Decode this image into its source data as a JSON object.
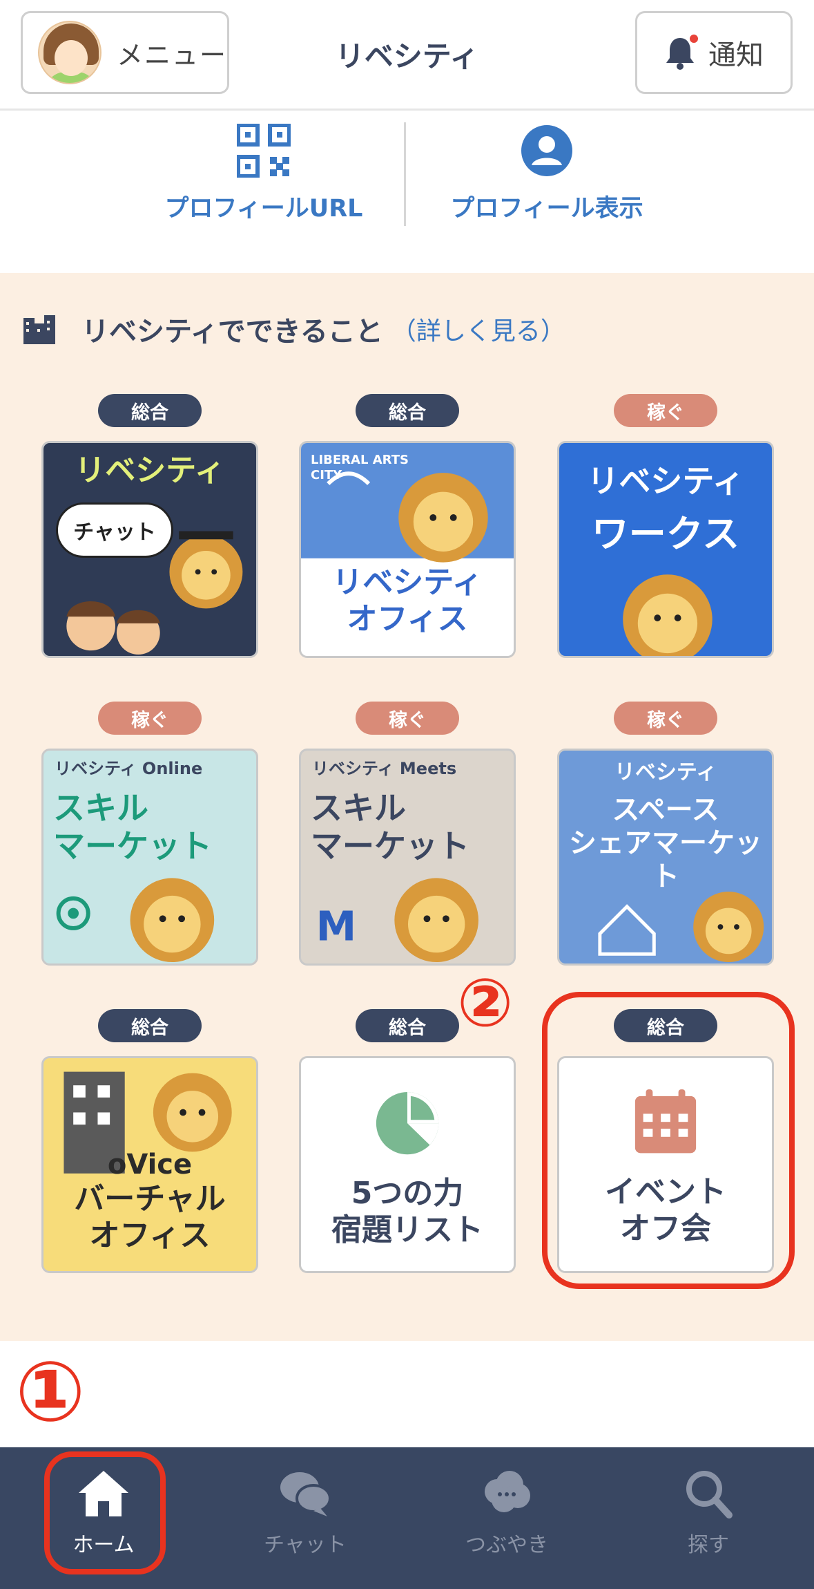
{
  "header": {
    "menu_label": "メニュー",
    "title": "リベシティ",
    "notify_label": "通知"
  },
  "profile_row": {
    "profile_url_label": "プロフィールURL",
    "profile_view_label": "プロフィール表示"
  },
  "services": {
    "title": "リベシティでできること",
    "more_label": "（詳しく見る）",
    "tiles": [
      {
        "tag": "総合",
        "tag_type": "general",
        "banner": "リベシティ",
        "text": "チャット",
        "theme": "#2f3b55"
      },
      {
        "tag": "総合",
        "tag_type": "general",
        "banner": "LIBERAL ARTS CITY",
        "text": "リベシティ\nオフィス",
        "theme": "#5b8ed8"
      },
      {
        "tag": "稼ぐ",
        "tag_type": "earn",
        "banner": "リベシティ",
        "text": "ワークス",
        "theme": "#2f6fd6"
      },
      {
        "tag": "稼ぐ",
        "tag_type": "earn",
        "banner": "リベシティ Online",
        "text": "スキル\nマーケット",
        "theme": "#c8e6e6"
      },
      {
        "tag": "稼ぐ",
        "tag_type": "earn",
        "banner": "リベシティ Meets",
        "text": "スキル\nマーケット",
        "theme": "#dcd5cc"
      },
      {
        "tag": "稼ぐ",
        "tag_type": "earn",
        "banner": "リベシティ",
        "text": "スペース\nシェアマーケット",
        "theme": "#6e9ad8"
      },
      {
        "tag": "総合",
        "tag_type": "general",
        "banner": "oVice",
        "text": "バーチャル\nオフィス",
        "theme": "#f7dc7a"
      },
      {
        "tag": "総合",
        "tag_type": "general",
        "banner": "",
        "text": "5つの力\n宿題リスト",
        "theme": "#ffffff"
      },
      {
        "tag": "総合",
        "tag_type": "general",
        "banner": "",
        "text": "イベント\nオフ会",
        "theme": "#ffffff"
      }
    ]
  },
  "annotations": {
    "marker_1": "①",
    "marker_2": "②"
  },
  "bottom_nav": {
    "items": [
      {
        "label": "ホーム",
        "icon": "home-icon"
      },
      {
        "label": "チャット",
        "icon": "chat-bubbles-icon"
      },
      {
        "label": "つぶやき",
        "icon": "cloud-bubble-icon"
      },
      {
        "label": "探す",
        "icon": "search-icon"
      }
    ]
  },
  "colors": {
    "accent_blue": "#3a78c3",
    "navy": "#394762",
    "earn_tag": "#d98b78",
    "service_bg": "#fcefe2",
    "annotation_red": "#e8331f"
  }
}
